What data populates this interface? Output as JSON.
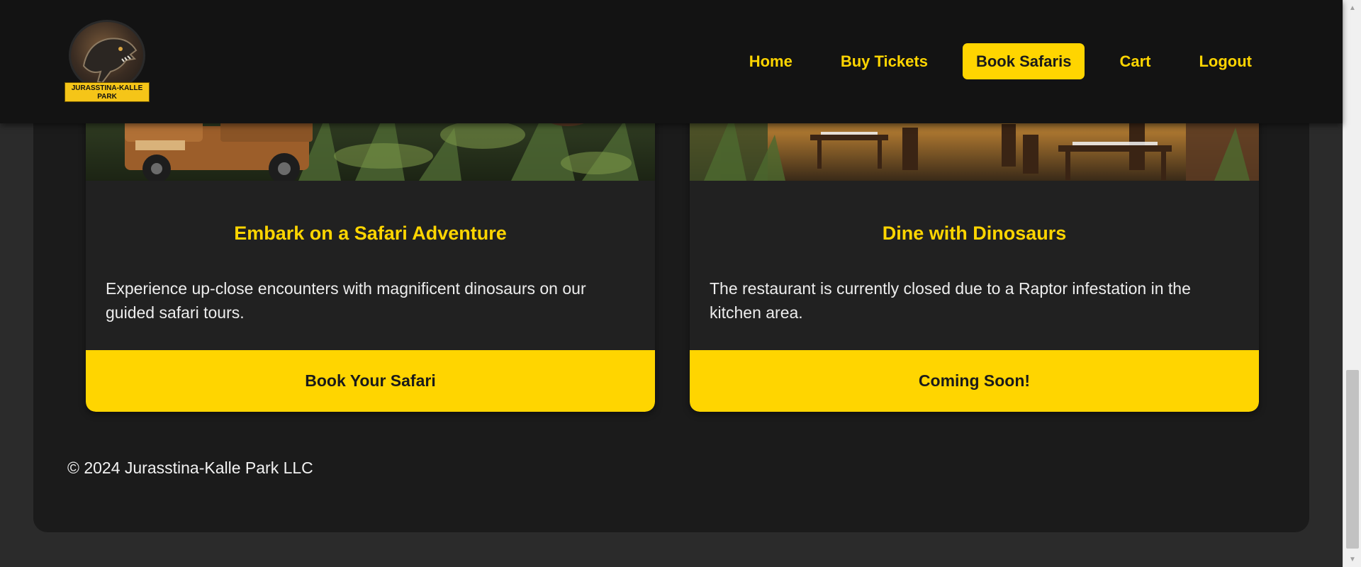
{
  "brand": {
    "logo_text": "JURASSTINA-KALLE PARK"
  },
  "nav": {
    "items": [
      {
        "label": "Home",
        "active": false
      },
      {
        "label": "Buy Tickets",
        "active": false
      },
      {
        "label": "Book Safaris",
        "active": true
      },
      {
        "label": "Cart",
        "active": false
      },
      {
        "label": "Logout",
        "active": false
      }
    ]
  },
  "cards": [
    {
      "title": "Embark on a Safari Adventure",
      "text": "Experience up-close encounters with magnificent dinosaurs on our guided safari tours.",
      "button_label": "Book Your Safari"
    },
    {
      "title": "Dine with Dinosaurs",
      "text": "The restaurant is currently closed due to a Raptor infestation in the kitchen area.",
      "button_label": "Coming Soon!"
    }
  ],
  "footer": {
    "copyright": "© 2024 Jurasstina-Kalle Park LLC"
  },
  "colors": {
    "accent": "#ffd500",
    "header_bg": "#131313",
    "panel_bg": "#1b1b1b",
    "card_bg": "#212121",
    "page_bg": "#2b2b2b"
  }
}
